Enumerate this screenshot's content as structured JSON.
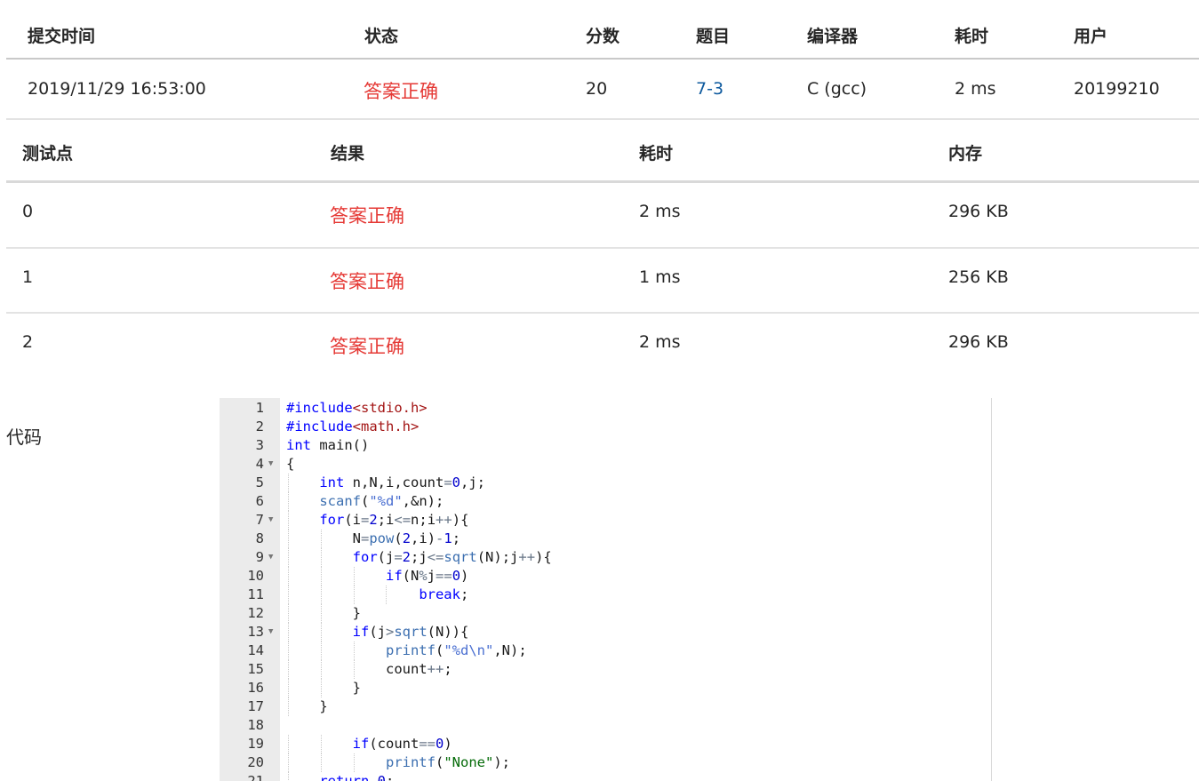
{
  "submission": {
    "headers": [
      "提交时间",
      "状态",
      "分数",
      "题目",
      "编译器",
      "耗时",
      "用户"
    ],
    "row": {
      "time": "2019/11/29 16:53:00",
      "status": "答案正确",
      "score": "20",
      "problem": "7-3",
      "compiler": "C (gcc)",
      "elapsed": "2 ms",
      "user": "20199210"
    }
  },
  "testcases": {
    "headers": [
      "测试点",
      "结果",
      "耗时",
      "内存"
    ],
    "rows": [
      {
        "id": "0",
        "result": "答案正确",
        "time": "2 ms",
        "memory": "296 KB"
      },
      {
        "id": "1",
        "result": "答案正确",
        "time": "1 ms",
        "memory": "256 KB"
      },
      {
        "id": "2",
        "result": "答案正确",
        "time": "2 ms",
        "memory": "296 KB"
      }
    ]
  },
  "code": {
    "label": "代码",
    "lines": [
      {
        "n": "1",
        "text": "#include<stdio.h>",
        "fold": false
      },
      {
        "n": "2",
        "text": "#include<math.h>",
        "fold": false
      },
      {
        "n": "3",
        "text": "int main()",
        "fold": false
      },
      {
        "n": "4",
        "text": "{",
        "fold": true
      },
      {
        "n": "5",
        "text": "    int n,N,i,count=0,j;",
        "fold": false
      },
      {
        "n": "6",
        "text": "    scanf(\"%d\",&n);",
        "fold": false
      },
      {
        "n": "7",
        "text": "    for(i=2;i<=n;i++){",
        "fold": true
      },
      {
        "n": "8",
        "text": "        N=pow(2,i)-1;",
        "fold": false
      },
      {
        "n": "9",
        "text": "        for(j=2;j<=sqrt(N);j++){",
        "fold": true
      },
      {
        "n": "10",
        "text": "            if(N%j==0)",
        "fold": false
      },
      {
        "n": "11",
        "text": "                break;",
        "fold": false
      },
      {
        "n": "12",
        "text": "        }",
        "fold": false
      },
      {
        "n": "13",
        "text": "        if(j>sqrt(N)){",
        "fold": true
      },
      {
        "n": "14",
        "text": "            printf(\"%d\\n\",N);",
        "fold": false
      },
      {
        "n": "15",
        "text": "            count++;",
        "fold": false
      },
      {
        "n": "16",
        "text": "        }",
        "fold": false
      },
      {
        "n": "17",
        "text": "    }",
        "fold": false
      },
      {
        "n": "18",
        "text": "",
        "fold": false
      },
      {
        "n": "19",
        "text": "        if(count==0)",
        "fold": false
      },
      {
        "n": "20",
        "text": "            printf(\"None\");",
        "fold": false
      },
      {
        "n": "21",
        "text": "    return 0;",
        "fold": false
      }
    ]
  },
  "colors": {
    "status_ok": "#e53935",
    "link": "#0e5a9e",
    "gutter": "#ebebeb"
  }
}
